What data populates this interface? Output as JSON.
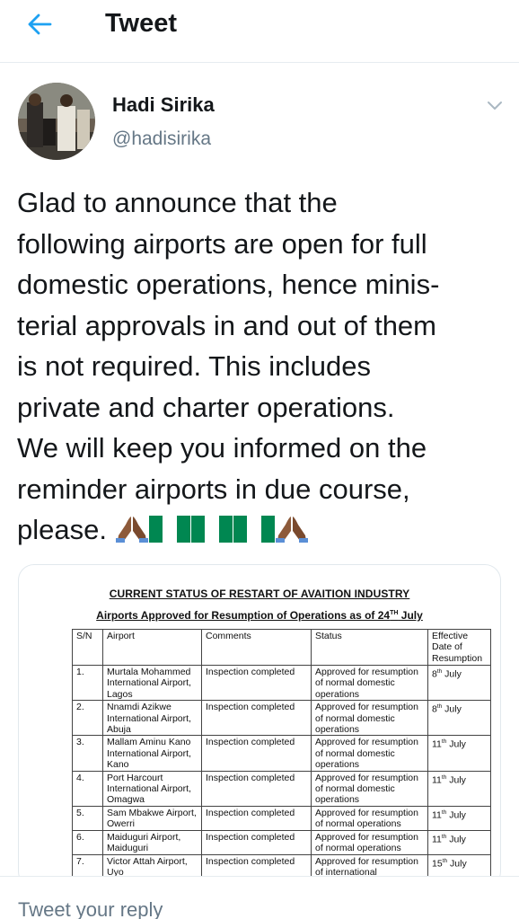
{
  "header": {
    "title": "Tweet",
    "back_icon": "arrow-left-icon",
    "accent_color": "#1da1f2"
  },
  "author": {
    "name": "Hadi Sirika",
    "handle": "@hadisirika",
    "menu_icon": "chevron-down-icon"
  },
  "tweet": {
    "lines": [
      "Glad to announce that the",
      "following airports are open for full",
      "domestic operations, hence minis-",
      "terial approvals in and out of them",
      "is not required. This includes",
      "private and charter operations.",
      "We will keep you informed on the",
      "reminder airports in due course,",
      "please."
    ],
    "emojis": [
      "folded-hands-icon",
      "nigeria-flag-icon",
      "nigeria-flag-icon",
      "nigeria-flag-icon",
      "folded-hands-icon"
    ]
  },
  "document": {
    "title": "CURRENT STATUS OF RESTART OF AVAITION INDUSTRY",
    "subtitle": "Airports Approved for Resumption of Operations as of 24",
    "subtitle_sup": "TH",
    "subtitle_end": " July",
    "headers": [
      "S/N",
      "Airport",
      "Comments",
      "Status",
      "Effective Date of Resumption"
    ],
    "rows": [
      {
        "sn": "1.",
        "airport": "Murtala Mohammed International Airport, Lagos",
        "comments": "Inspection completed",
        "status": "Approved for resumption of normal domestic operations",
        "date_day": "8",
        "date_sup": "th",
        "date_month": " July"
      },
      {
        "sn": "2.",
        "airport": "Nnamdi Azikwe International Airport, Abuja",
        "comments": "Inspection completed",
        "status": "Approved for resumption of normal domestic operations",
        "date_day": "8",
        "date_sup": "th",
        "date_month": " July"
      },
      {
        "sn": "3.",
        "airport": "Mallam Aminu Kano International Airport, Kano",
        "comments": "Inspection completed",
        "status": "Approved for resumption of normal domestic operations",
        "date_day": "11",
        "date_sup": "th",
        "date_month": " July"
      },
      {
        "sn": "4.",
        "airport": "Port Harcourt International Airport, Omagwa",
        "comments": "Inspection completed",
        "status": "Approved for resumption of normal domestic operations",
        "date_day": "11",
        "date_sup": "th",
        "date_month": " July"
      },
      {
        "sn": "5.",
        "airport": "Sam Mbakwe Airport, Owerri",
        "comments": "Inspection completed",
        "status": "Approved for resumption of normal operations",
        "date_day": "11",
        "date_sup": "th",
        "date_month": " July"
      },
      {
        "sn": "6.",
        "airport": "Maiduguri Airport, Maiduguri",
        "comments": "Inspection completed",
        "status": "Approved for resumption of normal operations",
        "date_day": "11",
        "date_sup": "th",
        "date_month": " July"
      },
      {
        "sn": "7.",
        "airport": "Victor Attah Airport, Uyo",
        "comments": "Inspection completed",
        "status": "Approved for resumption of international",
        "date_day": "15",
        "date_sup": "th",
        "date_month": " July"
      }
    ]
  },
  "reply": {
    "placeholder": "Tweet your reply"
  }
}
